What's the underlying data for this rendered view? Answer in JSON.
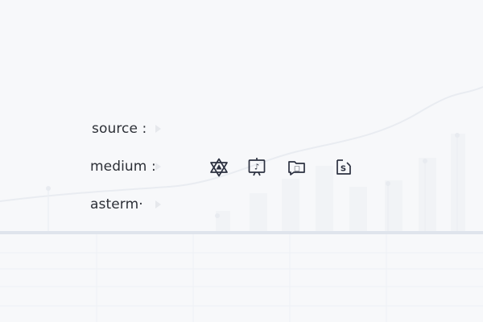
{
  "fields": [
    {
      "label": "source :",
      "icon": "chevron-right-icon"
    },
    {
      "label": "medium :",
      "icon": "chevron-right-icon"
    },
    {
      "label": "asterm·",
      "icon": "chevron-right-icon"
    }
  ],
  "toolbar": {
    "icons": [
      {
        "name": "star-of-david-icon"
      },
      {
        "name": "music-note-window-icon",
        "glyph": "♪"
      },
      {
        "name": "message-folder-icon",
        "glyph": "□"
      },
      {
        "name": "document-s-icon",
        "glyph": "S"
      }
    ]
  },
  "colors": {
    "background": "#f7f8fa",
    "text": "#2c2f36",
    "divider": "#dfe4ec",
    "icon_stroke": "#2c3140"
  }
}
